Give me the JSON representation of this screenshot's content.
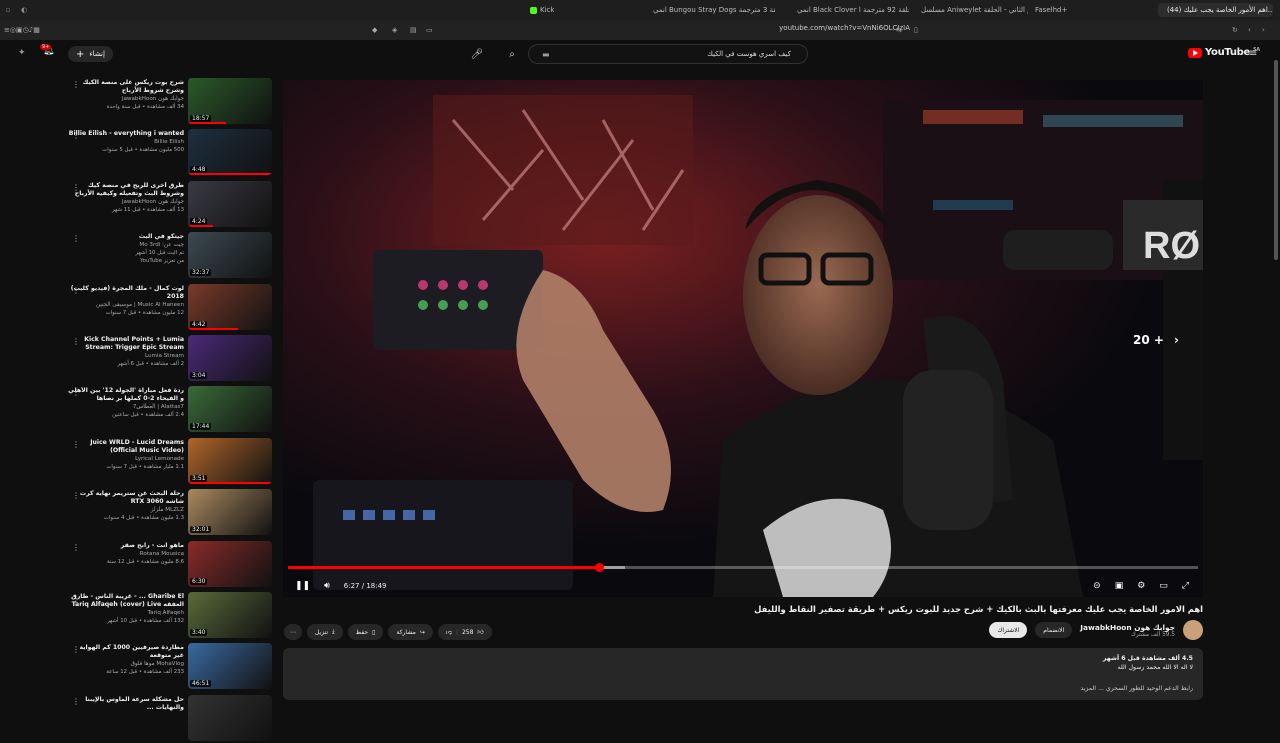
{
  "browser": {
    "tabs": [
      {
        "label": "Faselhd+",
        "color": "#d33"
      },
      {
        "label": "مسلسل Aniweylet الموسم الثاني - الحلقة",
        "color": "#c44"
      },
      {
        "label": "انمي Black Clover الحلقة 92 مترجمة ا...",
        "color": "#5a8"
      },
      {
        "label": "انمي Bungou Stray Dogs الحلقة 3 مترجمة",
        "color": "#58c"
      },
      {
        "label": "Kick",
        "color": "#53fc18"
      },
      {
        "label": "(44) اهم الأمور الخاصة يجب عليك...",
        "color": "#f00"
      }
    ],
    "url": "youtube.com/watch?v=VnNi6OLCIzIA"
  },
  "header": {
    "search_query": "كيف اسري هوست في الكيك",
    "create_label": "إنشاء",
    "notif_count": "9+",
    "logo_text": "YouTube",
    "logo_region": "SA"
  },
  "recommendations": [
    {
      "title": "شرح بوت ريكس على منصة الكيك وشرح شروط الأرباح",
      "channel": "جوابك هون JawabkHoon",
      "stats": "34 ألف مشاهدة • قبل سنة واحدة",
      "duration": "18:57",
      "progress": 0.45,
      "color": "#2a5a2a"
    },
    {
      "title": "Billie Eilish - everything i wanted",
      "channel": "Billie Eilish",
      "stats": "500 مليون مشاهدة • قبل 5 سنوات",
      "duration": "4:48",
      "progress": 1.0,
      "color": "#1e3040"
    },
    {
      "title": "طرق أخرى للربح في منصة كيك وشروط البث وتفعيله وكيفية الأرباح من البث",
      "channel": "جوابك هون JawabkHoon",
      "stats": "13 ألف مشاهدة • قبل 11 شهر",
      "duration": "4:24",
      "progress": 0.3,
      "color": "#3a3a44"
    },
    {
      "title": "جيتكو في البث",
      "channel": "جيت عن: Mo 3rdi",
      "stats": "تم البث قبل 10 أشهر",
      "extra": "من تعزيز YouTube",
      "duration": "32:37",
      "progress": 0,
      "color": "#3c4a52"
    },
    {
      "title": "لوت كمال - ملك المجرة (فيديو كليب) 2018",
      "channel": "Music Al Haneen | موسيقى الحنين",
      "stats": "12 مليون مشاهدة • قبل 7 سنوات",
      "duration": "4:42",
      "progress": 0.6,
      "color": "#7a3a2a"
    },
    {
      "title": "Kick Channel Points + Lumia Stream: Trigger Epic Stream",
      "channel": "Lumia Stream",
      "stats": "2 ألف مشاهدة • قبل 6 أشهر",
      "duration": "3:04",
      "progress": 0,
      "color": "#4b2a7a"
    },
    {
      "title": "ردة فعل مباراة 'الجولة 12' بين الأهلي و الفيحاء 2-0 كملها بر نصاها",
      "channel": "Alattas7 | العطاس7",
      "stats": "2.4 ألف مشاهدة • قبل ساعتين",
      "duration": "17:44",
      "progress": 0,
      "color": "#3a6a3a"
    },
    {
      "title": "Juice WRLD - Lucid Dreams (Official Music Video)",
      "channel": "Lyrical Lemonade",
      "stats": "1.1 مليار مشاهدة • قبل 7 سنوات",
      "duration": "3:51",
      "progress": 1.0,
      "color": "#b0652a"
    },
    {
      "title": "رحلة البحث عن ستريمر نهاية كرت شاشة RTX 3060",
      "channel": "MLZLZ ملزلز",
      "stats": "1.3 مليون مشاهدة • قبل 4 سنوات",
      "duration": "32:01",
      "progress": 0,
      "color": "#aa8a60"
    },
    {
      "title": "ماهو انت - رابح صقر",
      "channel": "Rotana Mousica",
      "stats": "8.6 مليون مشاهدة • قبل 12 سنة",
      "duration": "6:30",
      "progress": 0,
      "color": "#8a2a2a"
    },
    {
      "title": "Gharibe El ... - غريبة الناس - طارق العفقه Tariq Alfaqeh (cover) Live",
      "channel": "Tariq Alfaqeh",
      "stats": "132 ألف مشاهدة • قبل 10 أشهر",
      "duration": "3:40",
      "progress": 0,
      "color": "#5a6a3a"
    },
    {
      "title": "مطاردة صيرفيين 1000 كم الهواية غير متوقعة",
      "channel": "MohaVlog موها فلوق",
      "stats": "233 ألف مشاهدة • قبل 12 ساعة",
      "duration": "46:51",
      "progress": 0,
      "color": "#3a6aa0"
    },
    {
      "title": "حل مشكلة سرعة الماوس بالإيبنا والنهايات ...",
      "channel": "",
      "stats": "",
      "duration": "",
      "progress": 0,
      "color": "#333"
    }
  ],
  "player": {
    "current_time": "6:27",
    "duration": "18:49",
    "progress": 0.342,
    "buffered": 0.37,
    "skip_label": "20 +"
  },
  "video": {
    "title": "اهم الامور الخاصة يجب عليك معرفتها بالبث بالكيك + شرح جديد للبوت ريكس + طريقة تصفير النقاط والليفل",
    "channel_name": "جوابك هون JawabkHoon",
    "subscribers": "59.5 ألف مشترك",
    "join_label": "الانضمام",
    "subscribed_label": "الاشتراك",
    "likes": "258",
    "share_label": "مشاركة",
    "save_label": "حفظ",
    "download_label": "تنزيل",
    "description_stats": "4.5 ألف مشاهدة  قبل 6 أشهر",
    "description_line": "لا اله الا الله محمد رسول الله",
    "description_tags": "رابط الدعم الوحيد للطور السحري ... المزيد"
  }
}
